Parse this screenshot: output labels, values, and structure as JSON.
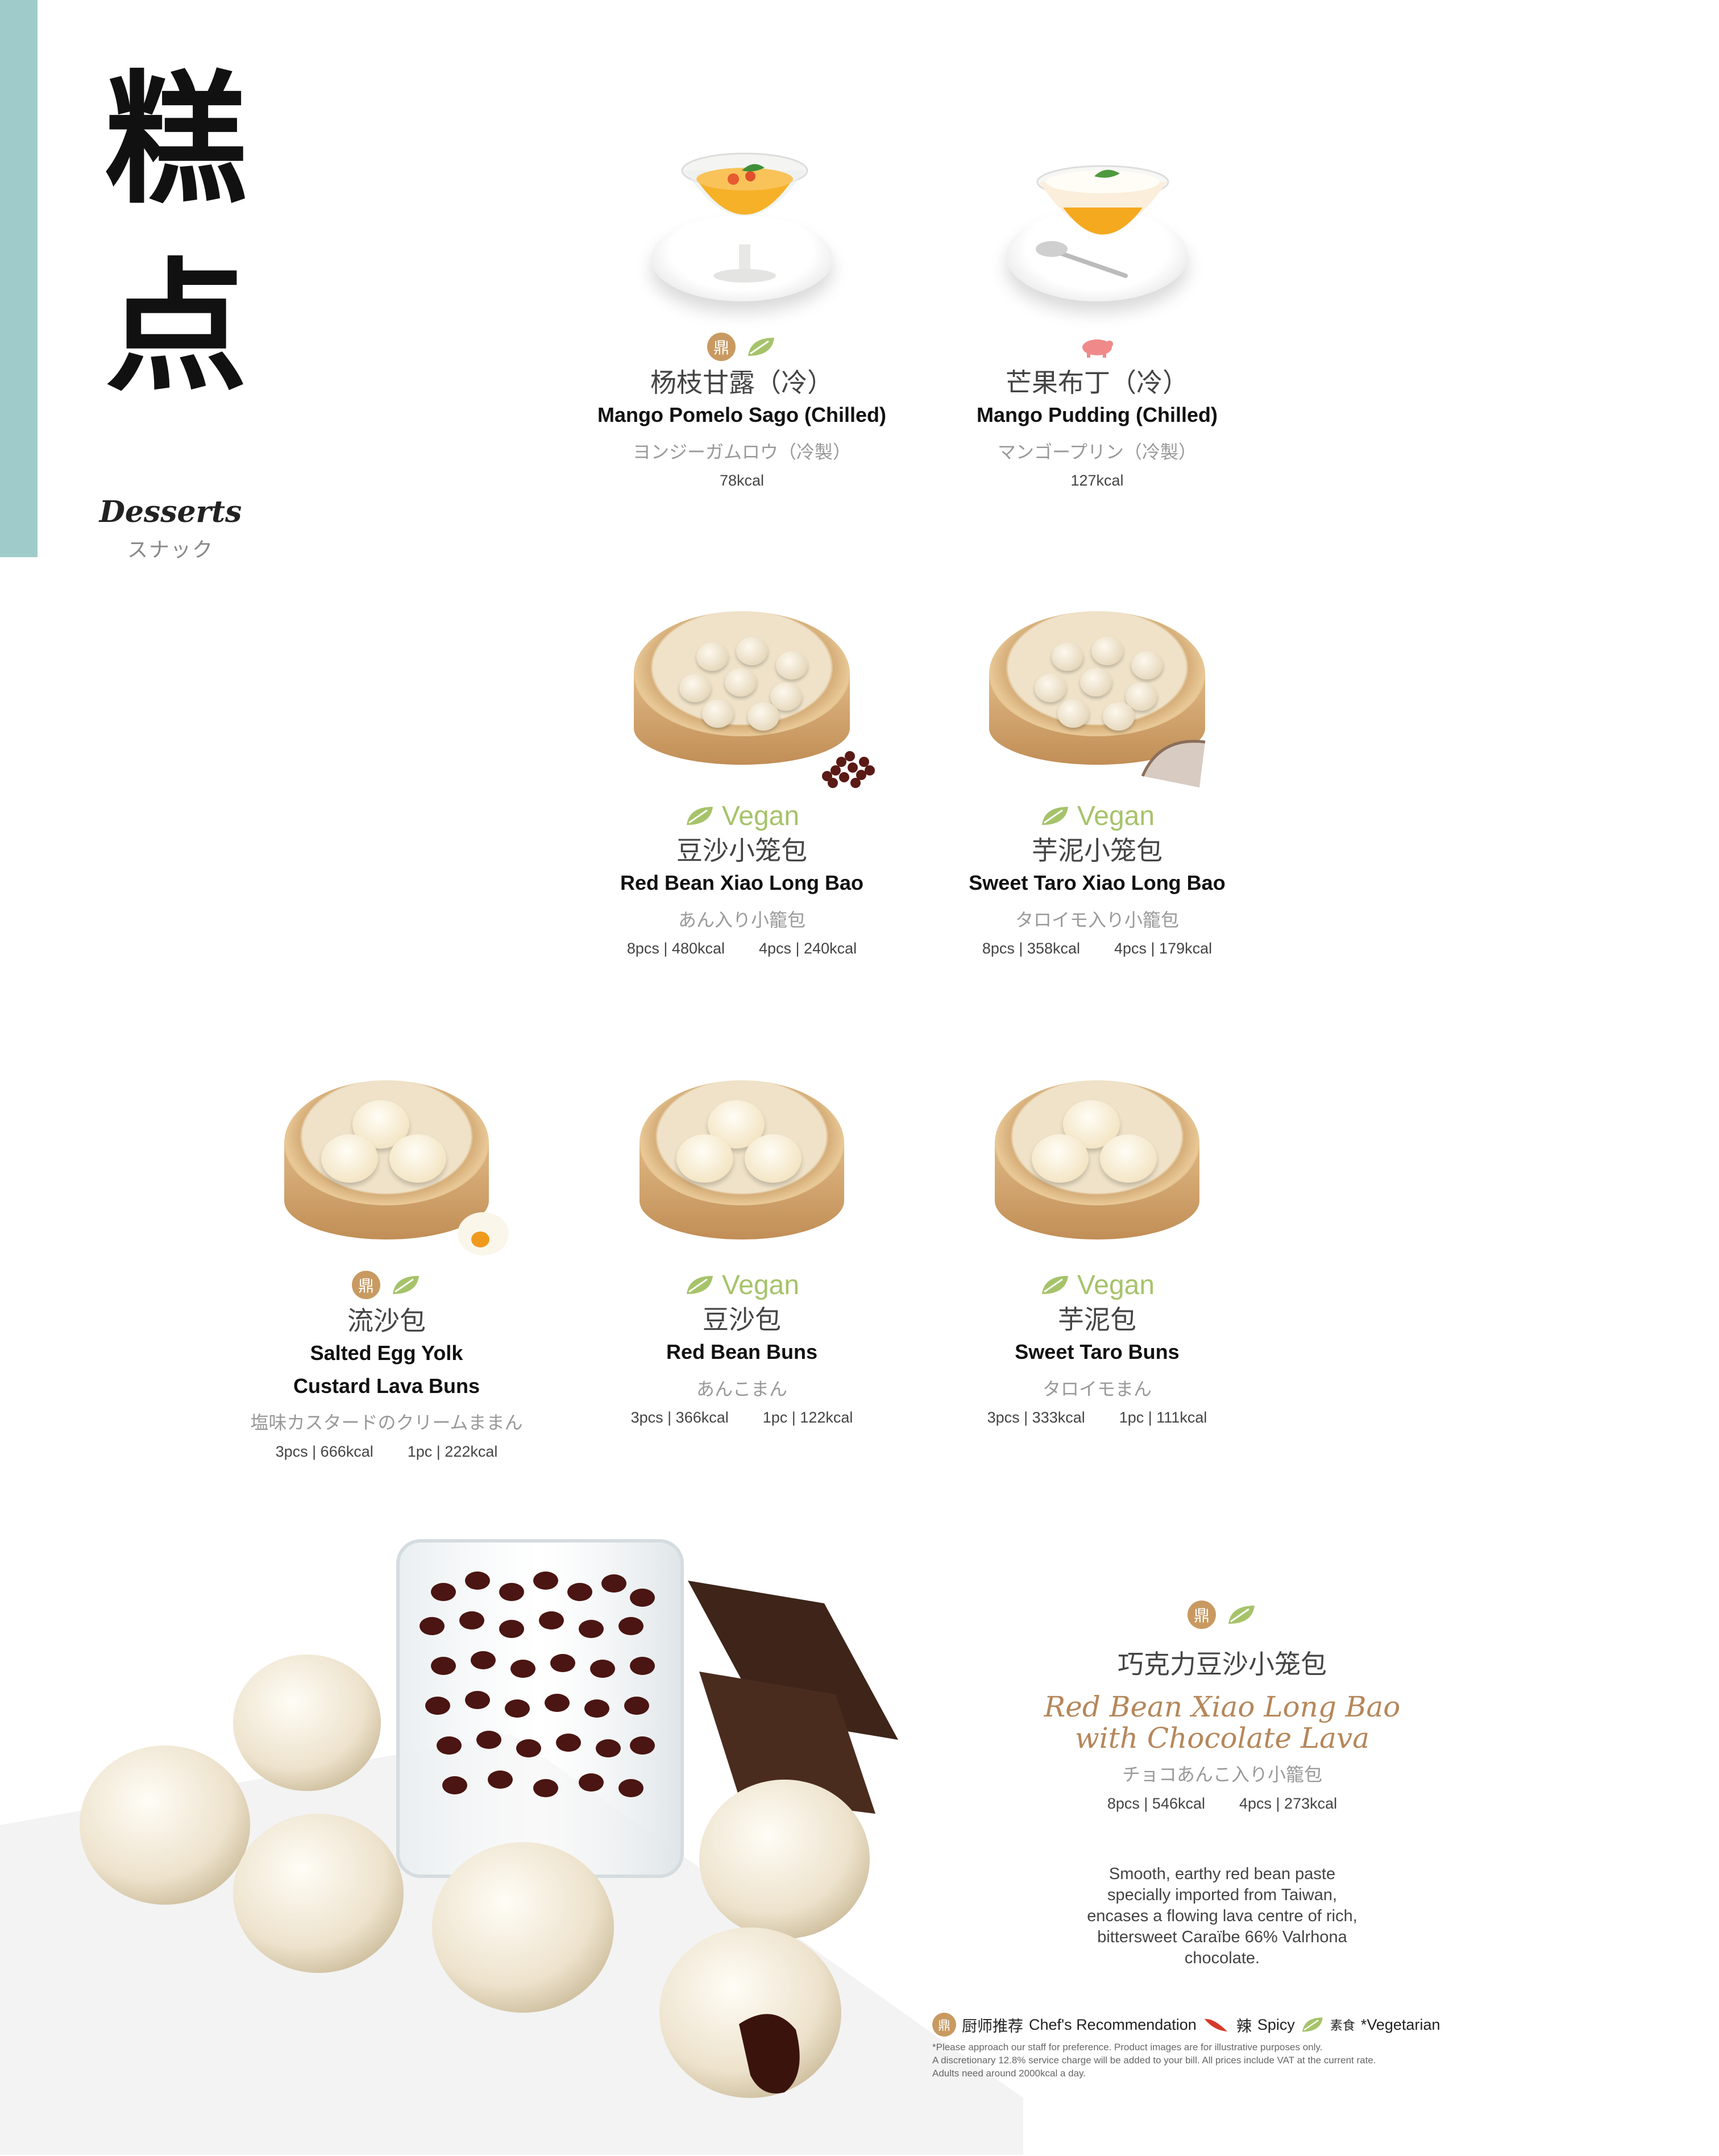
{
  "header": {
    "title_cjk_1": "糕",
    "title_cjk_2": "点",
    "title_en": "Desserts",
    "title_jp": "スナック"
  },
  "colors": {
    "sidebar_accent": "#9fcccb",
    "vegan_green": "#a6c36a",
    "chef_gold": "#c89a61",
    "feature_title": "#b5875a"
  },
  "items": [
    {
      "cn": "杨枝甘露（冷）",
      "en": "Mango Pomelo Sago (Chilled)",
      "jp": "ヨンジーガムロウ（冷製）",
      "kcal": [
        "78kcal"
      ],
      "icons": [
        "chef-recommendation-icon",
        "vegetarian-leaf-icon"
      ]
    },
    {
      "cn": "芒果布丁（冷）",
      "en": "Mango Pudding (Chilled)",
      "jp": "マンゴープリン（冷製）",
      "kcal": [
        "127kcal"
      ],
      "icons": [
        "pork-icon"
      ]
    },
    {
      "vegan_label": "Vegan",
      "cn": "豆沙小笼包",
      "en": "Red Bean Xiao Long Bao",
      "jp": "あん入り小籠包",
      "kcal": [
        "8pcs | 480kcal",
        "4pcs | 240kcal"
      ],
      "icons": [
        "vegan-leaf-icon"
      ]
    },
    {
      "vegan_label": "Vegan",
      "cn": "芋泥小笼包",
      "en": "Sweet Taro Xiao Long Bao",
      "jp": "タロイモ入り小籠包",
      "kcal": [
        "8pcs | 358kcal",
        "4pcs | 179kcal"
      ],
      "icons": [
        "vegan-leaf-icon"
      ]
    },
    {
      "cn": "流沙包",
      "en_1": "Salted Egg Yolk",
      "en_2": "Custard Lava Buns",
      "jp": "塩味カスタードのクリームままん",
      "kcal": [
        "3pcs | 666kcal",
        "1pc | 222kcal"
      ],
      "icons": [
        "chef-recommendation-icon",
        "vegetarian-leaf-icon"
      ]
    },
    {
      "vegan_label": "Vegan",
      "cn": "豆沙包",
      "en": "Red Bean Buns",
      "jp": "あんこまん",
      "kcal": [
        "3pcs | 366kcal",
        "1pc | 122kcal"
      ],
      "icons": [
        "vegan-leaf-icon"
      ]
    },
    {
      "vegan_label": "Vegan",
      "cn": "芋泥包",
      "en": "Sweet Taro Buns",
      "jp": "タロイモまん",
      "kcal": [
        "3pcs | 333kcal",
        "1pc | 111kcal"
      ],
      "icons": [
        "vegan-leaf-icon"
      ]
    }
  ],
  "feature": {
    "cn": "巧克力豆沙小笼包",
    "en_1": "Red Bean Xiao Long Bao",
    "en_2": "with Chocolate Lava",
    "jp": "チョコあんこ入り小籠包",
    "kcal": [
      "8pcs | 546kcal",
      "4pcs | 273kcal"
    ],
    "desc": [
      "Smooth, earthy red bean paste",
      "specially imported from Taiwan,",
      "encases a flowing lava centre of rich,",
      "bittersweet Caraïbe 66% Valrhona",
      "chocolate."
    ],
    "icons": [
      "chef-recommendation-icon",
      "vegetarian-leaf-icon"
    ]
  },
  "legend": {
    "chef_cn": "厨师推荐",
    "chef_en": "Chef's Recommendation",
    "spicy_cn": "辣",
    "spicy_en": "Spicy",
    "veg_cn": "素食",
    "veg_en": "*Vegetarian",
    "note_1": "*Please approach our staff for preference. Product images are for illustrative purposes only.",
    "note_2": "A discretionary 12.8% service charge will be added to your bill. All prices include VAT at the current rate.",
    "note_3": "Adults need around 2000kcal a day."
  },
  "chef_glyph": "鼎"
}
